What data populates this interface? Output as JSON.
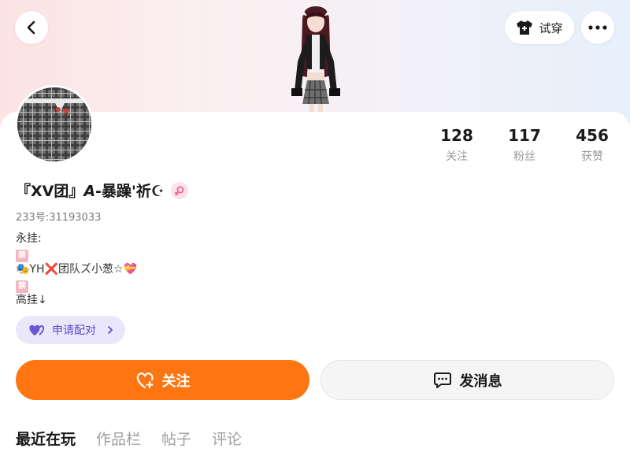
{
  "header": {
    "tryon_label": "试穿",
    "back_icon": "chevron-left-icon",
    "more_icon": "more-horizontal-icon",
    "tryon_icon": "tshirt-icon"
  },
  "profile": {
    "username": "『XV团』𝘼-暴躁'祈☪",
    "uid_label": "233号:",
    "uid_value": "31193033",
    "gender_icon": "female-icon",
    "stats": [
      {
        "value": "128",
        "label": "关注"
      },
      {
        "value": "117",
        "label": "粉丝"
      },
      {
        "value": "456",
        "label": "获赞"
      }
    ],
    "bio": [
      "永挂:",
      "禁",
      "🎭YH❌团队ズ小葱☆💝",
      "禁",
      "高挂↓"
    ],
    "ban_mark_text": "禁"
  },
  "actions": {
    "pair_label": "申请配对",
    "follow_label": "关注",
    "message_label": "发消息"
  },
  "tabs": [
    {
      "label": "最近在玩",
      "active": true
    },
    {
      "label": "作品栏",
      "active": false
    },
    {
      "label": "帖子",
      "active": false
    },
    {
      "label": "评论",
      "active": false
    }
  ],
  "colors": {
    "accent_orange": "#fe7512",
    "pair_purple": "#5e4bc7",
    "pair_bg": "#ebe7fb",
    "gender_pink": "#f06292"
  }
}
